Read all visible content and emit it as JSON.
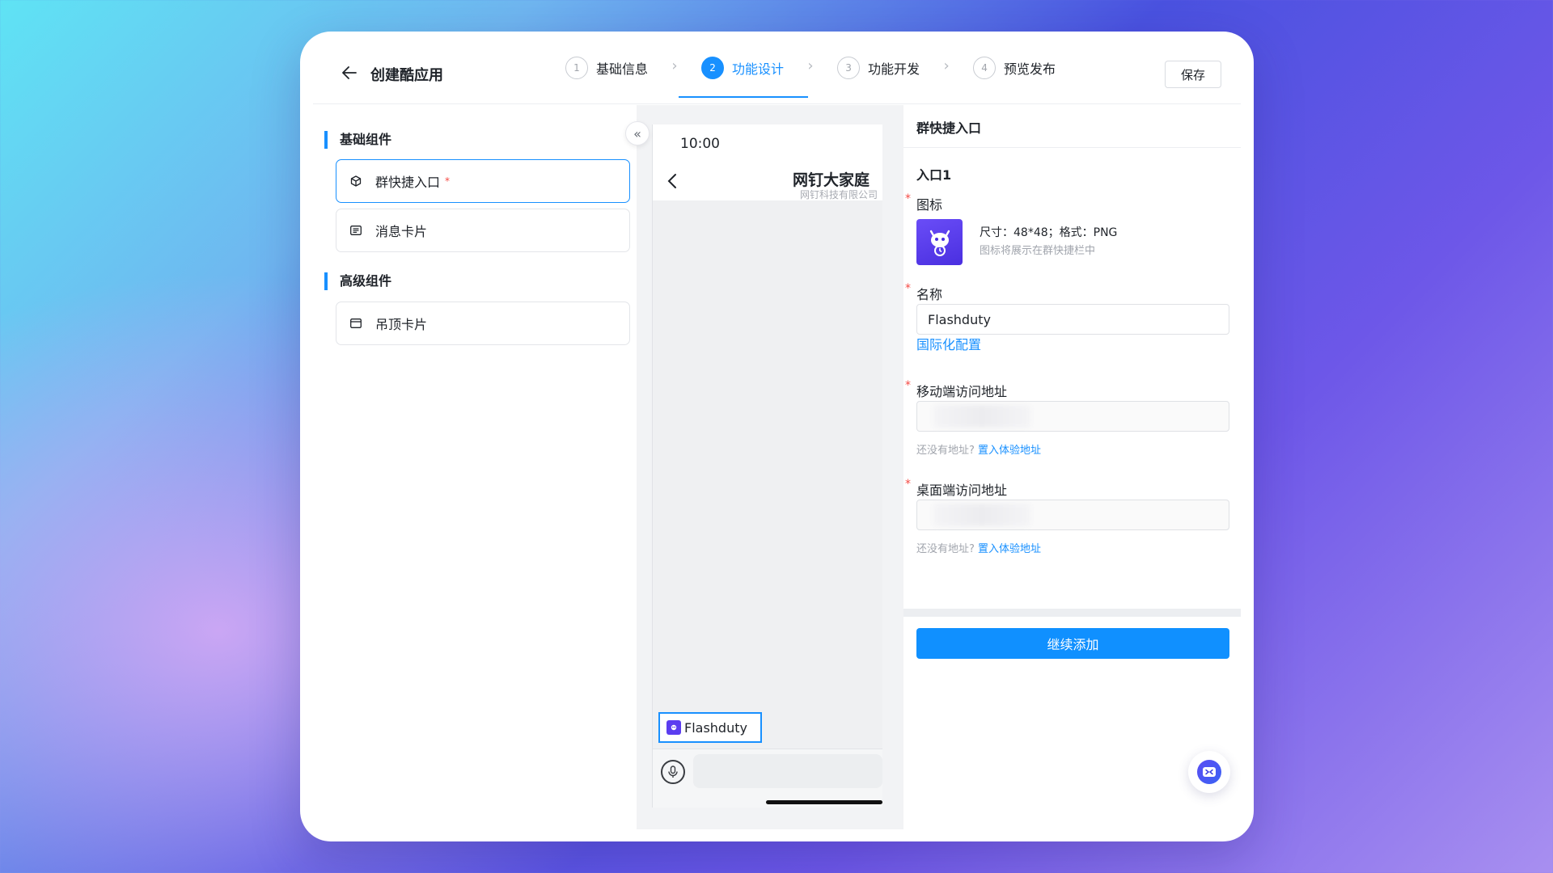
{
  "header": {
    "title": "创建酷应用",
    "save_label": "保存",
    "steps": [
      {
        "num": "1",
        "label": "基础信息"
      },
      {
        "num": "2",
        "label": "功能设计"
      },
      {
        "num": "3",
        "label": "功能开发"
      },
      {
        "num": "4",
        "label": "预览发布"
      }
    ],
    "active_step": "2"
  },
  "left": {
    "basic_title": "基础组件",
    "advanced_title": "高级组件",
    "basic_items": [
      {
        "label": "群快捷入口",
        "required_mark": "*"
      },
      {
        "label": "消息卡片"
      }
    ],
    "advanced_items": [
      {
        "label": "吊顶卡片"
      }
    ]
  },
  "phone": {
    "time": "10:00",
    "group_name": "网钉大家庭",
    "group_org": "网钉科技有限公司",
    "shortcut_label": "Flashduty"
  },
  "right": {
    "panel_title": "群快捷入口",
    "entry_title": "入口1",
    "icon_label": "图标",
    "icon_spec": "尺寸：48*48；格式：PNG",
    "icon_hint": "图标将展示在群快捷栏中",
    "name_label": "名称",
    "name_value": "Flashduty",
    "i18n_link": "国际化配置",
    "mobile_label": "移动端访问地址",
    "desktop_label": "桌面端访问地址",
    "no_addr_text": "还没有地址?",
    "fill_demo_link": "置入体验地址",
    "add_more_label": "继续添加",
    "required_mark": "*"
  },
  "colors": {
    "accent": "#1890ff",
    "required": "#f54a45"
  }
}
